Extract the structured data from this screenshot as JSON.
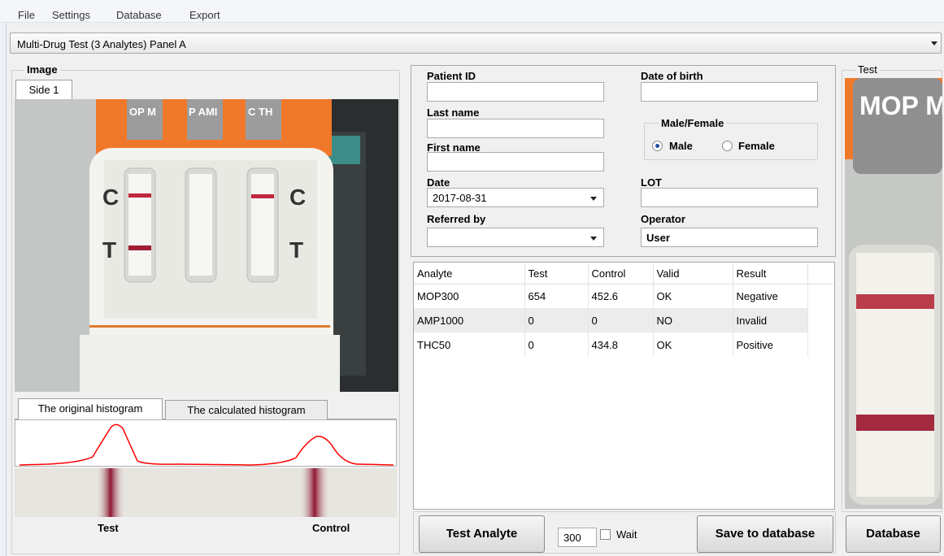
{
  "menu": [
    "File",
    "Settings",
    "Database",
    "Export"
  ],
  "panel_select": {
    "value": "Multi-Drug Test (3 Analytes) Panel A"
  },
  "image_group": {
    "title": "Image",
    "tab": "Side 1",
    "cassette": {
      "markers": [
        "C",
        "T",
        "C",
        "T"
      ],
      "caps": [
        "OP M",
        "P AMI",
        "C TH"
      ]
    }
  },
  "histogram": {
    "tabs": [
      "The original histogram",
      "The calculated histogram"
    ],
    "labels": [
      "Test",
      "Control"
    ]
  },
  "form": {
    "patient_id": {
      "label": "Patient ID",
      "value": ""
    },
    "date_of_birth": {
      "label": "Date of birth",
      "value": ""
    },
    "last_name": {
      "label": "Last name",
      "value": ""
    },
    "first_name": {
      "label": "First name",
      "value": ""
    },
    "gender": {
      "title": "Male/Female",
      "options": [
        "Male",
        "Female"
      ],
      "selected": "Male"
    },
    "date": {
      "label": "Date",
      "value": "2017-08-31"
    },
    "lot": {
      "label": "LOT",
      "value": ""
    },
    "referred_by": {
      "label": "Referred by",
      "value": ""
    },
    "operator": {
      "label": "Operator",
      "value": "User"
    }
  },
  "results_table": {
    "columns": [
      "Analyte",
      "Test",
      "Control",
      "Valid",
      "Result"
    ],
    "rows": [
      [
        "MOP300",
        "654",
        "452.6",
        "OK",
        "Negative"
      ],
      [
        "AMP1000",
        "0",
        "0",
        "NO",
        "Invalid"
      ],
      [
        "THC50",
        "0",
        "434.8",
        "OK",
        "Positive"
      ]
    ]
  },
  "test_group": {
    "title": "Test",
    "strip_label": "MOP M"
  },
  "buttons": {
    "test_analyte": "Test Analyte",
    "save": "Save to  database",
    "database": "Database"
  },
  "wait": {
    "value": "300",
    "label": "Wait"
  },
  "colors": {
    "line_red": "#c0283c",
    "histogram_red": "#ff0000",
    "orange": "#f0782a"
  }
}
